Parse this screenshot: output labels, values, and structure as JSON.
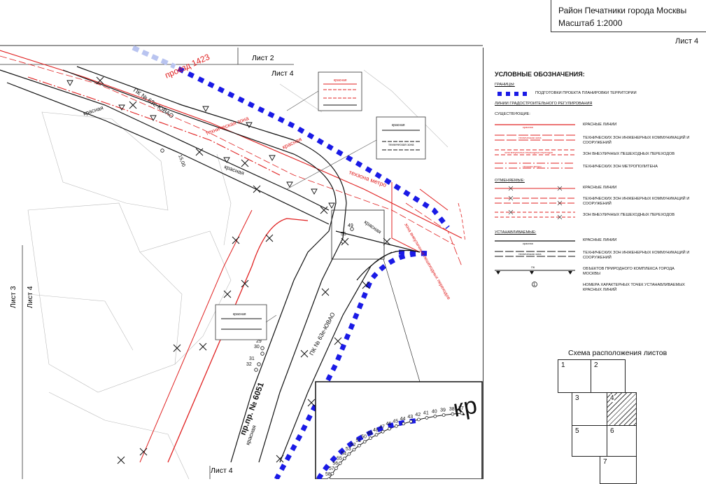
{
  "title_block": {
    "line1": "Район Печатники города Москвы",
    "line2": "Масштаб 1:2000"
  },
  "sheet_number": "Лист 4",
  "map": {
    "sheet_labels": {
      "top_left": "Лист 2",
      "top_right": "Лист 4",
      "left_a": "Лист 3",
      "left_b": "Лист 4",
      "bottom": "Лист 4"
    },
    "road_labels": {
      "proezd": "проезд 1423",
      "pk1": "ПК № 63е-ЮВАО",
      "pk2": "ПК № 63е-ЮВАО",
      "main_road": "пр.пр. № 6051",
      "zone1": "техническая зона",
      "zone2": "техзона метро",
      "zone3": "зона внеуличных пешеходных переходов",
      "krasnaya": "красная",
      "krasnaya2": "красная",
      "krasnaya3": "красная",
      "krasnaya4": "красная",
      "dim": "15,00"
    },
    "point_numbers": [
      "49",
      "55",
      "29",
      "30",
      "31",
      "32"
    ],
    "inset_points": [
      "58",
      "57",
      "56",
      "55",
      "54",
      "53",
      "52",
      "51",
      "50",
      "49",
      "48",
      "47",
      "46",
      "45",
      "44",
      "43",
      "42",
      "41",
      "40",
      "39",
      "38",
      "37"
    ],
    "inset_text": "кр",
    "callout_label": "красная",
    "callout_sub": "техническая зона"
  },
  "legend": {
    "title": "УСЛОВНЫЕ ОБОЗНАЧЕНИЯ:",
    "borders_heading": "ГРАНИЦЫ:",
    "border_item": "ПОДГОТОВКИ ПРОЕКТА ПЛАНИРОВКИ ТЕРРИТОРИИ",
    "lines_heading": "ЛИНИИ ГРАДОСТРОИТЕЛЬНОГО РЕГУЛИРОВАНИЯ",
    "existing_heading": "СУЩЕСТВУЮЩИЕ:",
    "existing": [
      "КРАСНЫЕ ЛИНИИ",
      "ТЕХНИЧЕСКИХ ЗОН ИНЖЕНЕРНЫХ КОММУНИКАЦИЙ И СООРУЖЕНИЙ",
      "ЗОН ВНЕУЛИЧНЫХ ПЕШЕХОДНЫХ ПЕРЕХОДОВ",
      "ТЕХНИЧЕСКИХ ЗОН МЕТРОПОЛИТЕНА"
    ],
    "cancelled_heading": "ОТМЕНЯЕМЫЕ:",
    "cancelled": [
      "КРАСНЫЕ ЛИНИИ",
      "ТЕХНИЧЕСКИХ ЗОН ИНЖЕНЕРНЫХ КОММУНИКАЦИЙ И СООРУЖЕНИЙ",
      "ЗОН ВНЕУЛИЧНЫХ ПЕШЕХОДНЫХ ПЕРЕХОДОВ"
    ],
    "established_heading": "УСТАНАВЛИВАЕМЫЕ:",
    "established": [
      "КРАСНЫЕ ЛИНИИ",
      "ТЕХНИЧЕСКИХ ЗОН ИНЖЕНЕРНЫХ КОММУНИКАЦИЙ И СООРУЖЕНИЙ",
      "ОБЪЕКТОВ ПРИРОДНОГО КОМПЛЕКСА ГОРОДА МОСКВЫ",
      "НОМЕРА ХАРАКТЕРНЫХ ТОЧЕК УСТАНАВЛИВАЕМЫХ КРАСНЫХ ЛИНИЙ"
    ],
    "sample_labels": {
      "krasnaya": "красная",
      "tech_zone": "техническая зона",
      "ped_zone": "зона внеуличных пешеходных переходов",
      "metro_zone": "техзона метро",
      "pk": "ПК",
      "point_no": "1"
    },
    "scheme_title": "Схема расположения листов",
    "scheme_cells": [
      "1",
      "2",
      "3",
      "4",
      "5",
      "6",
      "7"
    ]
  },
  "colors": {
    "red_line": "#e02020",
    "border_blue": "#1a1ae6",
    "black": "#111111"
  }
}
